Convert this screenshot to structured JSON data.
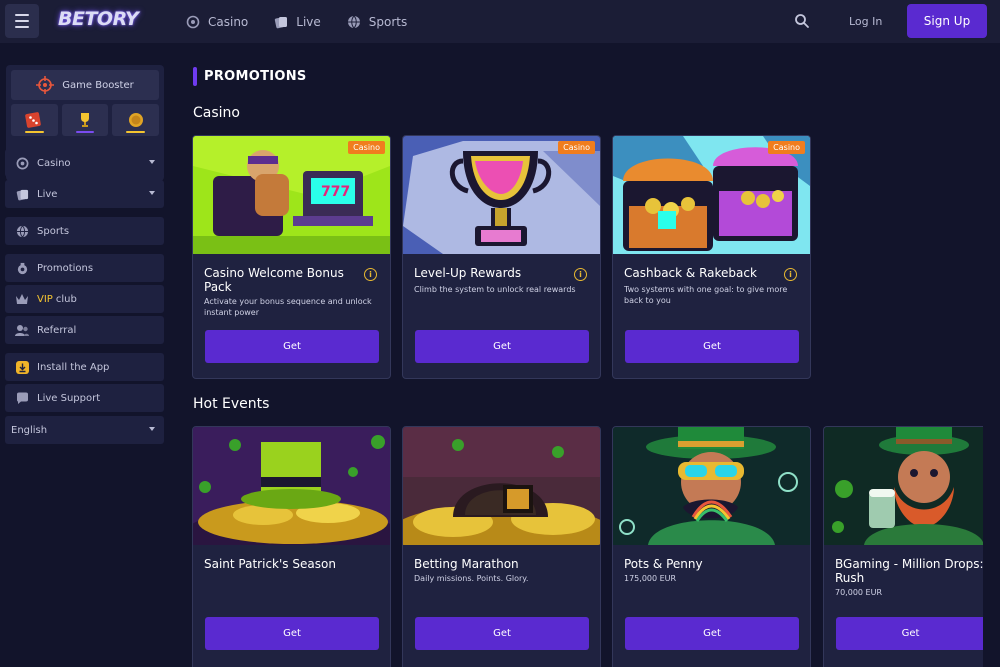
{
  "header": {
    "logo": "BETORY",
    "nav": [
      {
        "label": "Casino",
        "icon": "casino-chip-icon"
      },
      {
        "label": "Live",
        "icon": "live-cards-icon"
      },
      {
        "label": "Sports",
        "icon": "sports-ball-icon"
      }
    ],
    "login_label": "Log In",
    "signup_label": "Sign Up"
  },
  "sidebar": {
    "booster_label": "Game Booster",
    "booster_tiles": [
      {
        "icon": "dice-icon",
        "bar_color": "#f4c430"
      },
      {
        "icon": "trophy-icon",
        "bar_color": "#7a4cf0"
      },
      {
        "icon": "coin-icon",
        "bar_color": "#f4c430"
      }
    ],
    "items": [
      {
        "label": "Casino",
        "icon": "casino-chip-icon"
      },
      {
        "label": "Live",
        "icon": "live-cards-icon"
      },
      {
        "label": "Sports",
        "icon": "sports-ball-icon"
      },
      {
        "label": "Promotions",
        "icon": "promotions-icon"
      },
      {
        "label_prefix": "VIP",
        "label": "club",
        "icon": "crown-icon"
      },
      {
        "label": "Referral",
        "icon": "referral-icon"
      },
      {
        "label": "Install the App",
        "icon": "download-icon"
      },
      {
        "label": "Live Support",
        "icon": "chat-icon"
      },
      {
        "label": "English",
        "icon": ""
      }
    ]
  },
  "main": {
    "page_title": "PROMOTIONS",
    "sections": [
      {
        "title": "Casino",
        "cards": [
          {
            "title": "Casino Welcome Bonus Pack",
            "description": "Activate your bonus sequence and unlock instant power",
            "badge": "Casino",
            "button": "Get"
          },
          {
            "title": "Level-Up Rewards",
            "description": "Climb the system to unlock real rewards",
            "badge": "Casino",
            "button": "Get"
          },
          {
            "title": "Cashback & Rakeback",
            "description": "Two systems with one goal: to give more back to you",
            "badge": "Casino",
            "button": "Get"
          }
        ]
      },
      {
        "title": "Hot Events",
        "cards": [
          {
            "title": "Saint Patrick's Season",
            "description": "",
            "button": "Get"
          },
          {
            "title": "Betting Marathon",
            "description": "Daily missions. Points. Glory.",
            "button": "Get"
          },
          {
            "title": "Pots & Penny",
            "description": "175,000 EUR",
            "button": "Get"
          },
          {
            "title": "BGaming - Million Drops: Rush",
            "description": "70,000 EUR",
            "button": "Get"
          }
        ]
      }
    ]
  },
  "colors": {
    "accent": "#5a2ad0",
    "badge": "#f07d1e",
    "gold": "#f4c430",
    "background": "#12142b"
  }
}
